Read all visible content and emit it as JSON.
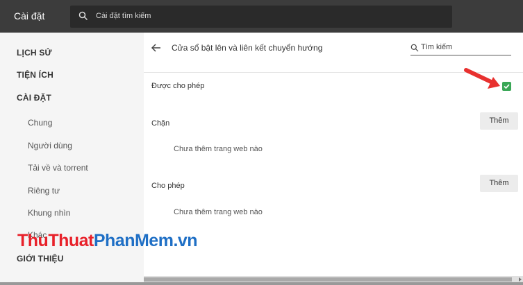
{
  "header": {
    "app_title": "Cài đặt",
    "search_placeholder": "Cài đặt tìm kiếm"
  },
  "sidebar": {
    "history": "LỊCH SỬ",
    "extensions": "TIỆN ÍCH",
    "settings": "CÀI ĐẶT",
    "items": [
      "Chung",
      "Người dùng",
      "Tải về và torrent",
      "Riêng tư",
      "Khung nhìn",
      "Khác"
    ],
    "about": "GIỚI THIỆU"
  },
  "main": {
    "title": "Cửa sổ bật lên và liên kết chuyển hướng",
    "search_placeholder": "Tìm kiếm",
    "allowed_label": "Được cho phép",
    "allowed_checked": true,
    "block": {
      "label": "Chặn",
      "button": "Thêm",
      "empty_text": "Chưa thêm trang web nào"
    },
    "allow": {
      "label": "Cho phép",
      "button": "Thêm",
      "empty_text": "Chưa thêm trang web nào"
    }
  },
  "watermark": {
    "part1": "ThuThuat",
    "part2": "PhanMem",
    "part3": ".vn"
  },
  "colors": {
    "topbar": "#3c3c3c",
    "checkbox": "#3aa757",
    "arrow": "#e8312f"
  }
}
